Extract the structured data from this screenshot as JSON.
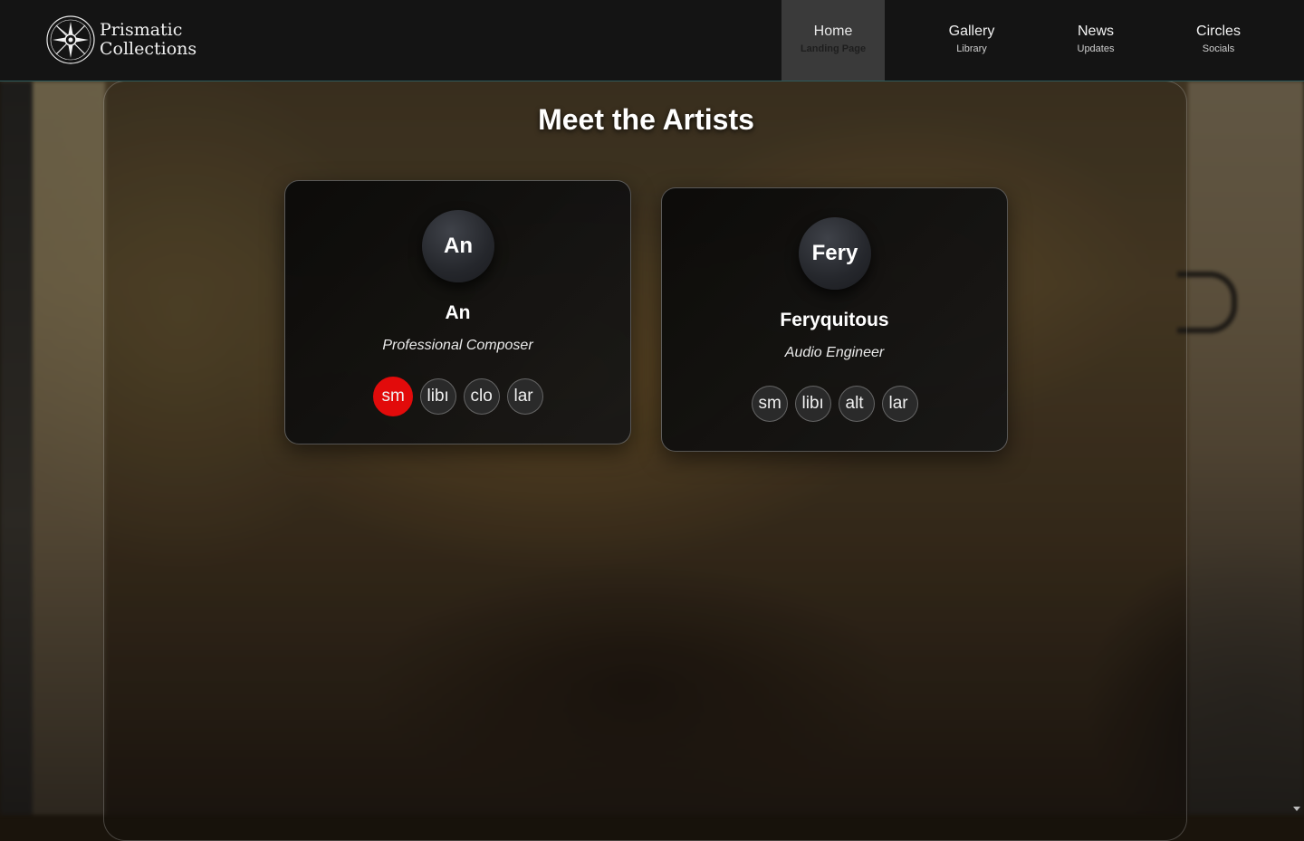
{
  "brand": {
    "line1": "Prismatic",
    "line2": "Collections"
  },
  "nav": [
    {
      "label": "Home",
      "sub": "Landing Page",
      "active": true
    },
    {
      "label": "Gallery",
      "sub": "Library"
    },
    {
      "label": "News",
      "sub": "Updates"
    },
    {
      "label": "Circles",
      "sub": "Socials"
    }
  ],
  "page": {
    "title": "Meet the Artists"
  },
  "artists": [
    {
      "initials": "An",
      "name": "An",
      "role": "Professional Composer",
      "links": [
        "sm",
        "libı",
        "clo",
        "lar"
      ]
    },
    {
      "initials": "Fery",
      "name": "Feryquitous",
      "role": "Audio Engineer",
      "links": [
        "sm",
        "libı",
        "alt",
        "lar"
      ]
    }
  ],
  "colors": {
    "header_bg": "#141414",
    "active_tab": "#3a3a3a",
    "header_border": "#2f5d5e",
    "hover_social": "#e20b0b"
  },
  "icons": {
    "logo": "compass-star-logo",
    "scroll": "scroll-down-arrow"
  }
}
